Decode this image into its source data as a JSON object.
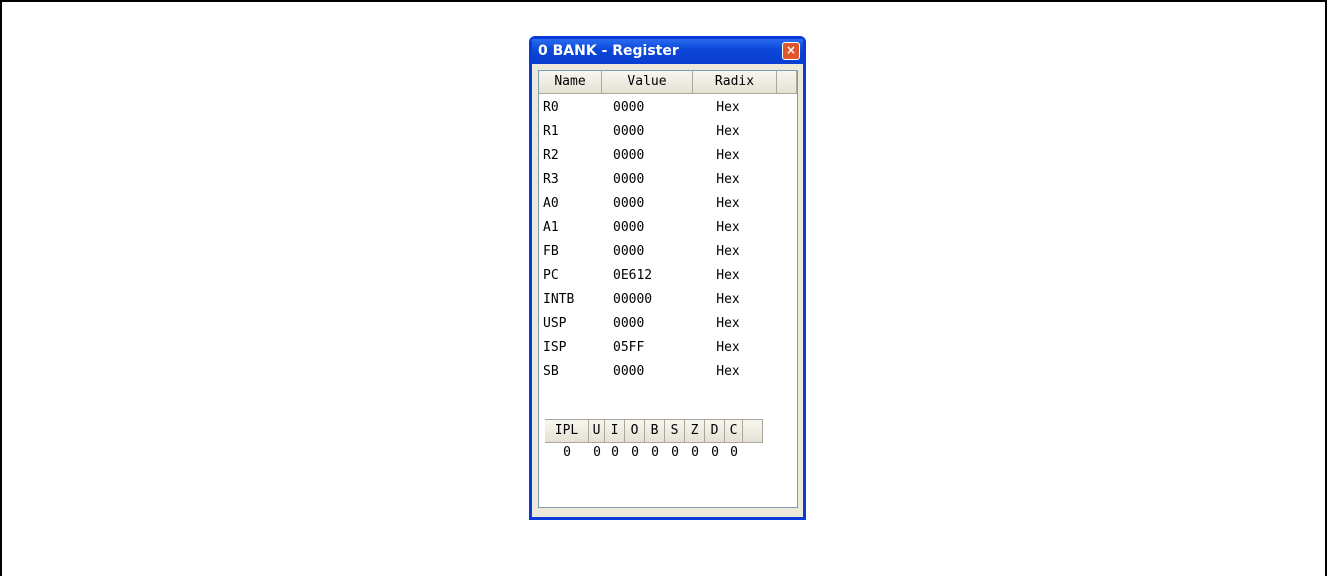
{
  "window": {
    "title": "0 BANK - Register",
    "close_label": "×"
  },
  "table": {
    "headers": [
      "Name",
      "Value",
      "Radix"
    ],
    "rows": [
      {
        "name": "R0",
        "value": "0000",
        "radix": "Hex"
      },
      {
        "name": "R1",
        "value": "0000",
        "radix": "Hex"
      },
      {
        "name": "R2",
        "value": "0000",
        "radix": "Hex"
      },
      {
        "name": "R3",
        "value": "0000",
        "radix": "Hex"
      },
      {
        "name": "A0",
        "value": "0000",
        "radix": "Hex"
      },
      {
        "name": "A1",
        "value": "0000",
        "radix": "Hex"
      },
      {
        "name": "FB",
        "value": "0000",
        "radix": "Hex"
      },
      {
        "name": "PC",
        "value": "0E612",
        "radix": "Hex"
      },
      {
        "name": "INTB",
        "value": "00000",
        "radix": "Hex"
      },
      {
        "name": "USP",
        "value": "0000",
        "radix": "Hex"
      },
      {
        "name": "ISP",
        "value": "05FF",
        "radix": "Hex"
      },
      {
        "name": "SB",
        "value": "0000",
        "radix": "Hex"
      }
    ]
  },
  "flags": {
    "headers": [
      "IPL",
      "U",
      "I",
      "O",
      "B",
      "S",
      "Z",
      "D",
      "C"
    ],
    "values": [
      "0",
      "0",
      "0",
      "0",
      "0",
      "0",
      "0",
      "0",
      "0"
    ]
  },
  "colors": {
    "titlebar": "#0b47d8",
    "close": "#e0572b",
    "client": "#ece9d8"
  }
}
